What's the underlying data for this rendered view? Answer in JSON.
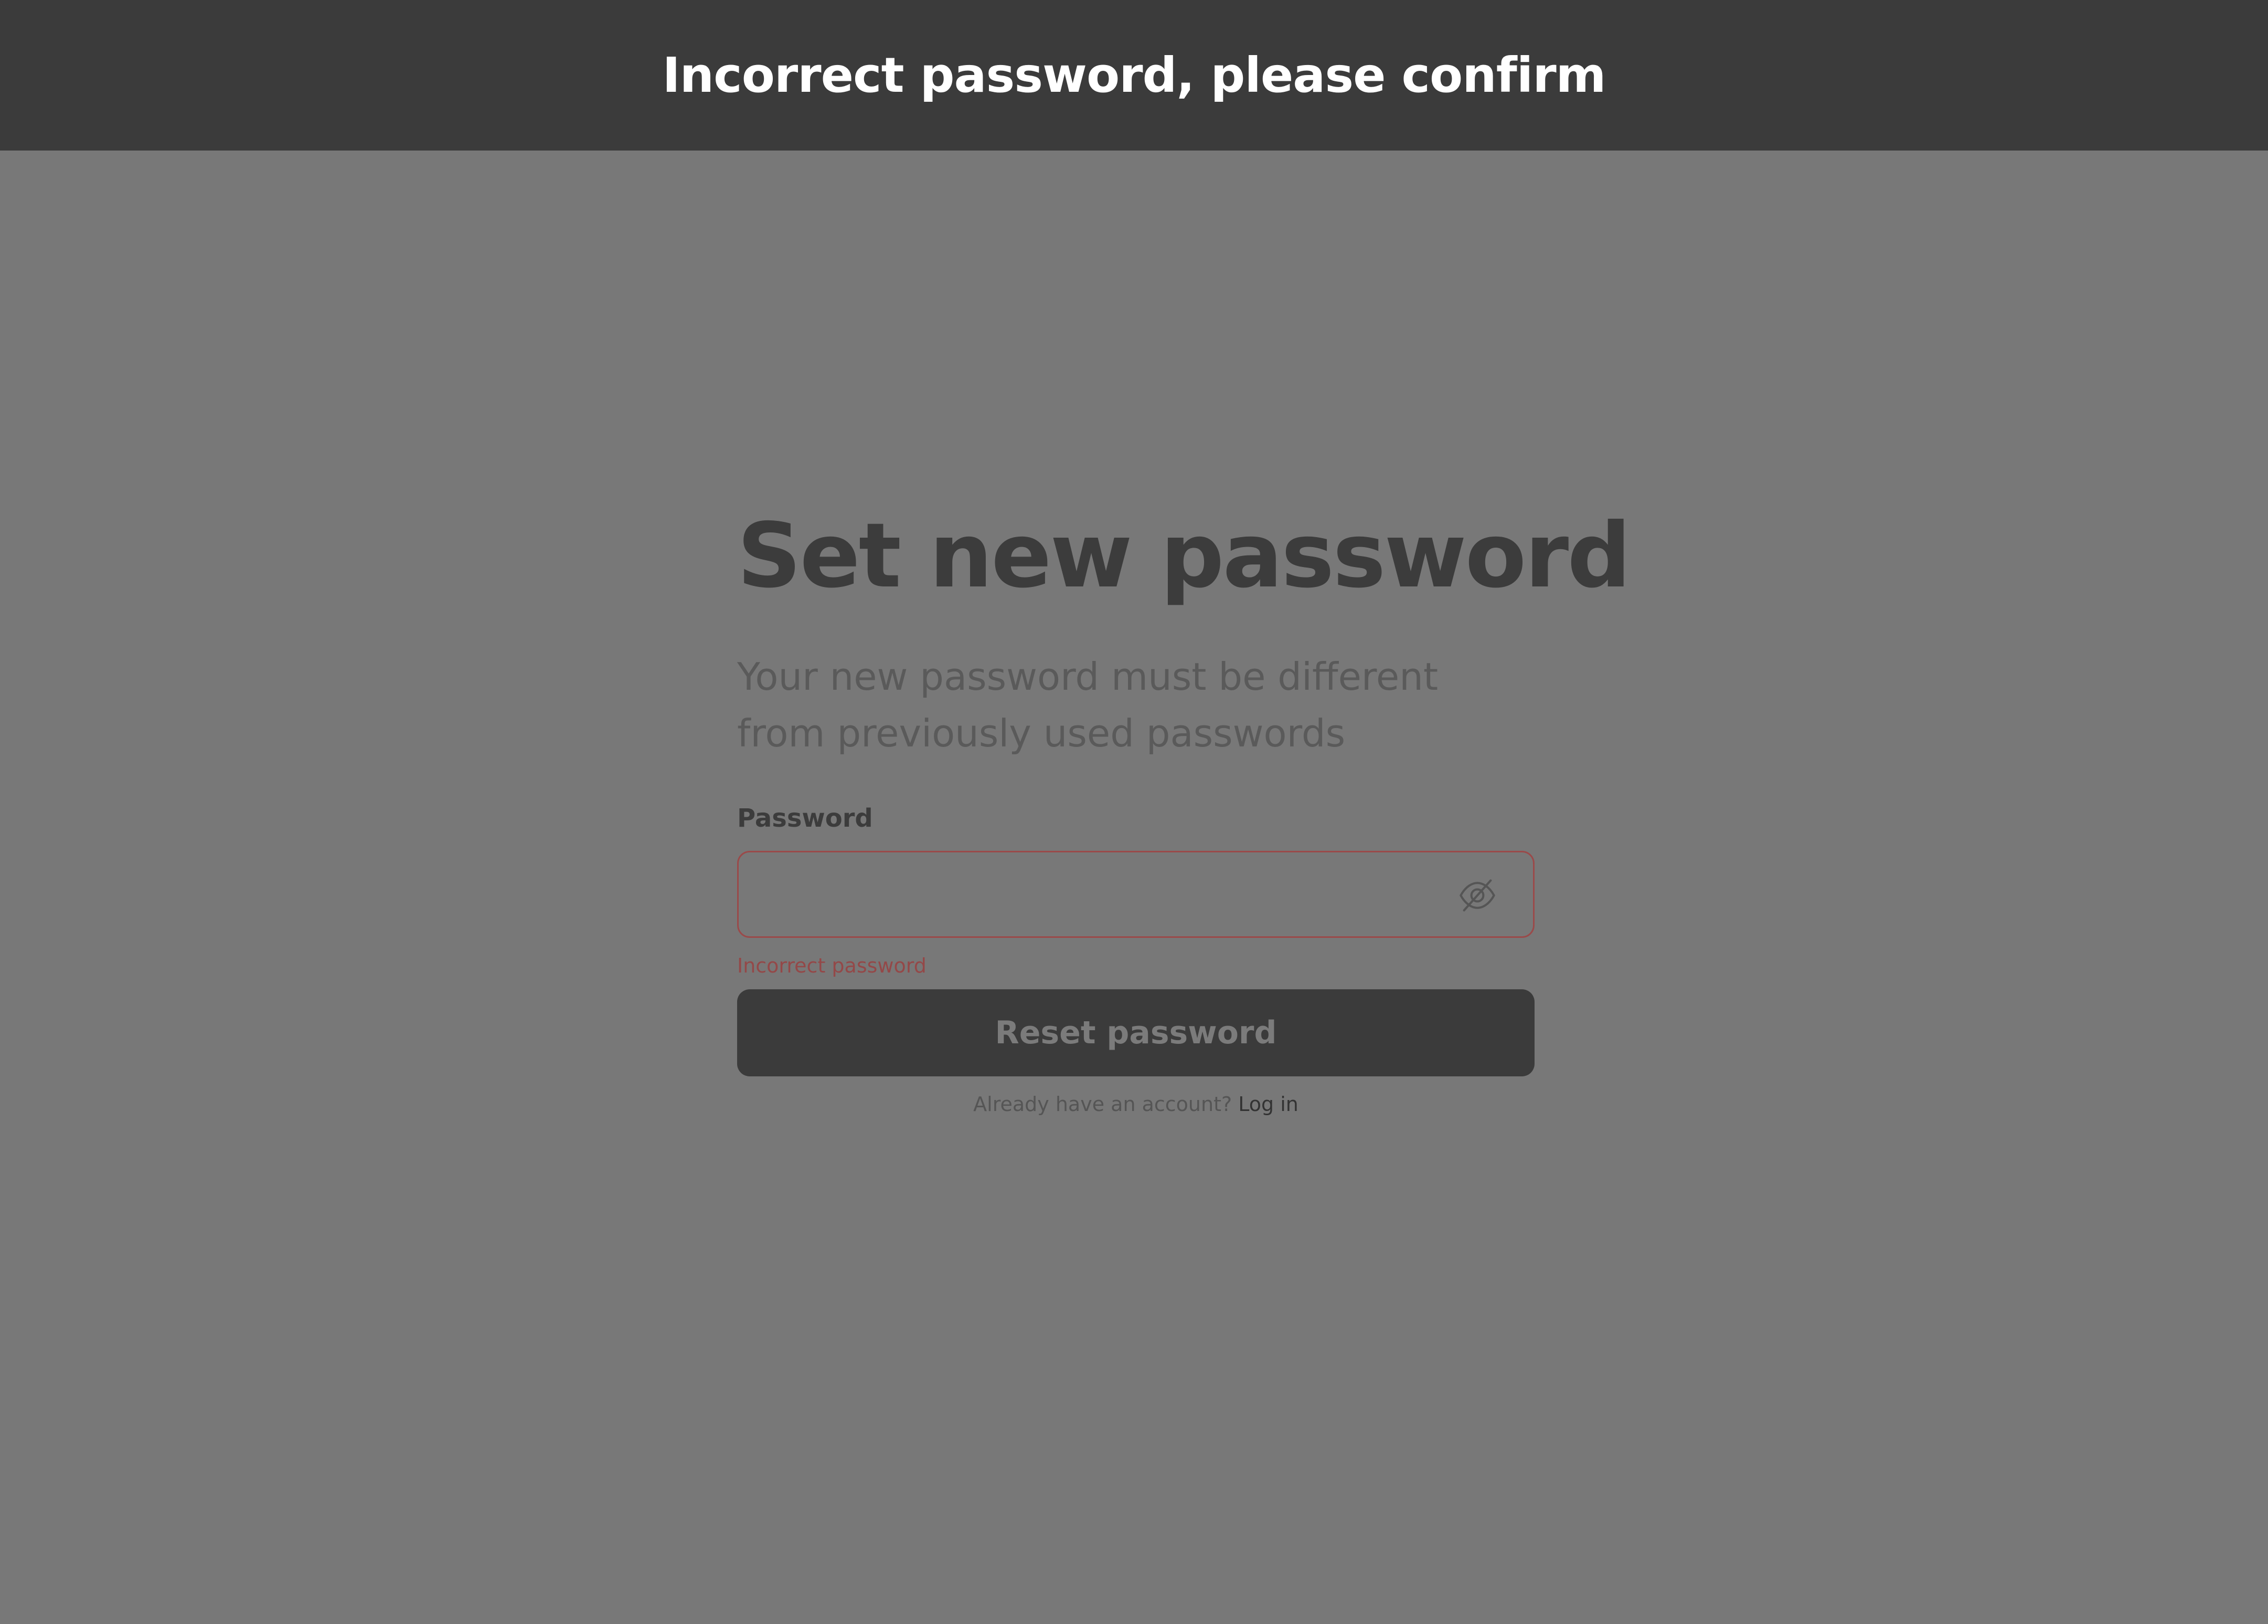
{
  "banner": {
    "text": "Incorrect password, please confirm"
  },
  "form": {
    "title": "Set new password",
    "subtitle": "Your new password must be different from previously used passwords",
    "password_label": "Password",
    "password_value": "",
    "password_visibility_icon": "eye-off-icon",
    "error_message": "Incorrect password",
    "submit_label": "Reset password"
  },
  "footer": {
    "prompt": "Already have an account?",
    "link_label": "Log in"
  },
  "colors": {
    "banner_bg": "#3b3b3b",
    "overlay_bg": "#787878",
    "error": "#944848",
    "button_bg": "#3b3b3b"
  }
}
